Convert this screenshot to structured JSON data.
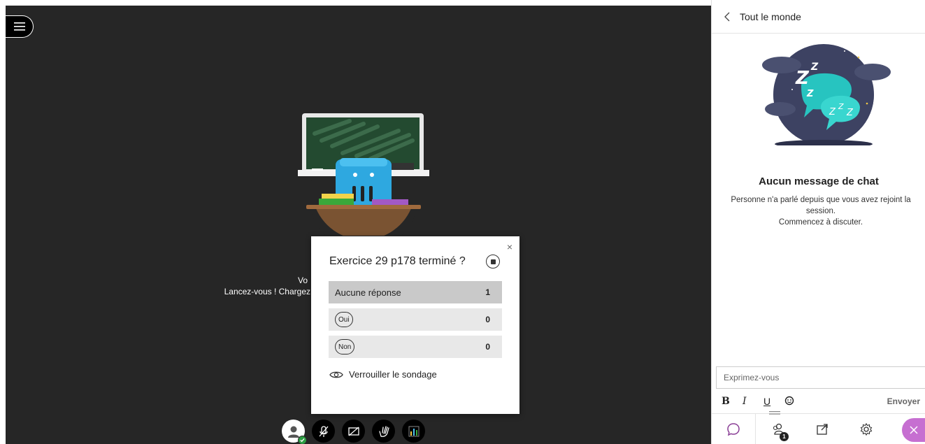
{
  "stage": {
    "welcome_line1": "Vo",
    "welcome_line2": "Lancez-vous ! Chargez"
  },
  "poll": {
    "title": "Exercice 29 p178 terminé ?",
    "rows": [
      {
        "label": "Aucune réponse",
        "count": "1"
      },
      {
        "label": "Oui",
        "count": "0"
      },
      {
        "label": "Non",
        "count": "0"
      }
    ],
    "lock_label": "Verrouiller le sondage",
    "close_glyph": "×"
  },
  "panel": {
    "title": "Tout le monde",
    "empty_title": "Aucun message de chat",
    "empty_line1": "Personne n'a parlé depuis que vous avez rejoint la session.",
    "empty_line2": "Commencez à discuter.",
    "input_placeholder": "Exprimez-vous",
    "format": {
      "bold": "B",
      "italic": "I",
      "underline": "U"
    },
    "send_label": "Envoyer",
    "people_count": "1"
  },
  "icons": {
    "menu": "hamburger-icon",
    "back": "chevron-left-icon",
    "stop": "stop-icon",
    "eye": "eye-icon",
    "mic_off": "microphone-off-icon",
    "camera_off": "camera-off-icon",
    "hand": "raise-hand-icon",
    "poll": "poll-chart-icon",
    "chat": "chat-bubble-icon",
    "people": "people-icon",
    "share": "share-icon",
    "settings": "gear-icon",
    "close": "close-icon",
    "emoji": "emoji-icon"
  },
  "colors": {
    "stage_bg": "#262626",
    "accent_purple": "#c66fd1",
    "status_green": "#2e9e44",
    "poll_row_selected": "#c9c9c9",
    "poll_row": "#e8e8e8"
  }
}
